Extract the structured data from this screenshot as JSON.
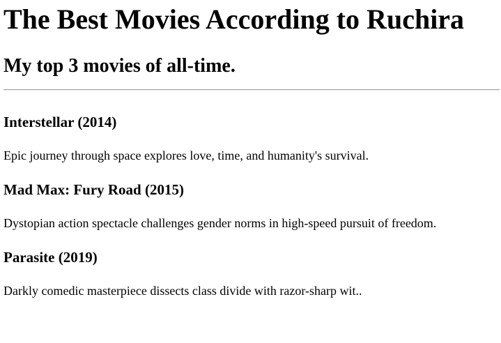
{
  "page": {
    "title": "The Best Movies According to Ruchira",
    "subtitle": "My top 3 movies of all-time."
  },
  "movies": [
    {
      "title": "Interstellar (2014)",
      "description": "Epic journey through space explores love, time, and humanity's survival."
    },
    {
      "title": "Mad Max: Fury Road (2015)",
      "description": "Dystopian action spectacle challenges gender norms in high-speed pursuit of freedom."
    },
    {
      "title": "Parasite (2019)",
      "description": "Darkly comedic masterpiece dissects class divide with razor-sharp wit.."
    }
  ]
}
